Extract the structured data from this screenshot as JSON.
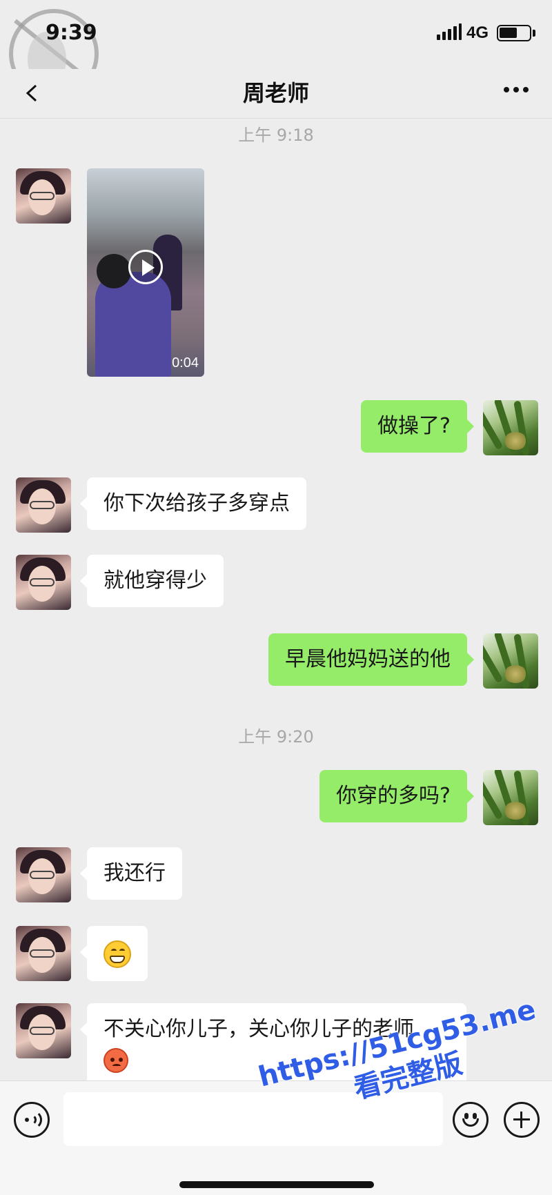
{
  "status_bar": {
    "time": "9:39",
    "network": "4G",
    "battery_level": 0.6
  },
  "nav": {
    "title": "周老师"
  },
  "messages": [
    {
      "type": "timestamp",
      "text": "上午 9:18"
    },
    {
      "type": "video",
      "sender": "teacher",
      "duration": "0:04"
    },
    {
      "type": "text",
      "sender": "me",
      "text": "做操了?"
    },
    {
      "type": "text",
      "sender": "teacher",
      "text": "你下次给孩子多穿点"
    },
    {
      "type": "text",
      "sender": "teacher",
      "text": "就他穿得少"
    },
    {
      "type": "text",
      "sender": "me",
      "text": "早晨他妈妈送的他"
    },
    {
      "type": "timestamp",
      "text": "上午 9:20"
    },
    {
      "type": "text",
      "sender": "me",
      "text": "你穿的多吗?"
    },
    {
      "type": "text",
      "sender": "teacher",
      "text": "我还行"
    },
    {
      "type": "emoji",
      "sender": "teacher",
      "emoji": "grinning-face"
    },
    {
      "type": "text",
      "sender": "teacher",
      "text": "不关心你儿子，关心你儿子的老师",
      "emoji": "angry-face"
    }
  ],
  "input": {
    "value": "",
    "placeholder": ""
  },
  "watermark": {
    "line1": "https://51cg53.me",
    "line2": "看完整版"
  },
  "colors": {
    "background": "#ededed",
    "bubble_self": "#95ec69",
    "bubble_other": "#ffffff",
    "timestamp": "#a7a7a7",
    "watermark": "#2f5de6"
  },
  "icons": [
    "back-icon",
    "more-icon",
    "play-icon",
    "voice-icon",
    "emoji-icon",
    "plus-icon",
    "signal-icon",
    "battery-icon"
  ]
}
